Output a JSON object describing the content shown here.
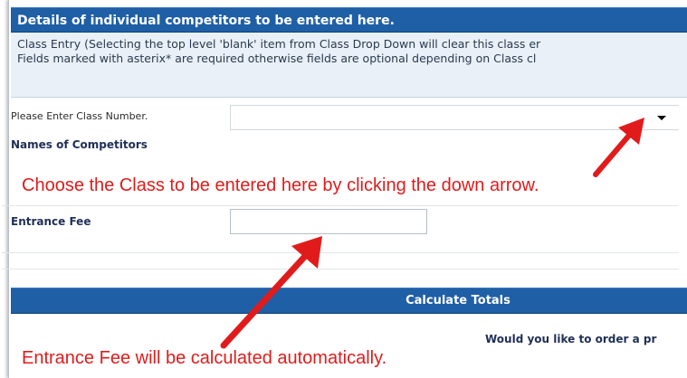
{
  "header": {
    "title": "Details of individual competitors to be entered here."
  },
  "info": {
    "line1": "Class Entry (Selecting the top level 'blank' item from Class Drop Down will clear this class er",
    "line2": "Fields marked with asterix* are required otherwise fields are optional depending on Class cl"
  },
  "form": {
    "class_label": "Please Enter Class Number.",
    "class_selected": "",
    "names_label": "Names of Competitors",
    "fee_label": "Entrance Fee",
    "fee_value": ""
  },
  "footer": {
    "calculate_label": "Calculate Totals"
  },
  "order": {
    "question": "Would you like to order a pr"
  },
  "annotations": {
    "class_hint": "Choose the Class to be entered here by clicking the down arrow.",
    "fee_hint": "Entrance Fee will be calculated automatically."
  },
  "colors": {
    "header_blue": "#1f5fa6",
    "annotation_red": "#e11b1b",
    "label_navy": "#1f2f55"
  },
  "icons": {
    "dropdown": "chevron-down-icon",
    "annotation_arrow": "arrow-icon"
  }
}
